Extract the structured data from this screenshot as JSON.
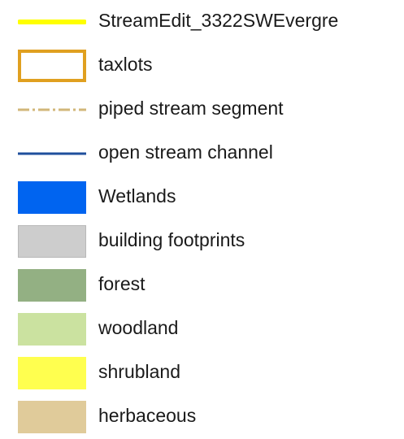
{
  "legend": {
    "items": [
      {
        "label": "StreamEdit_3322SWEvergre",
        "symbol": "line-solid-thick",
        "color": "#ffff00"
      },
      {
        "label": "taxlots",
        "symbol": "outline-box",
        "color": "#e0a020"
      },
      {
        "label": "piped stream segment",
        "symbol": "line-dash-dot",
        "color": "#d2b77a"
      },
      {
        "label": "open stream channel",
        "symbol": "line-solid",
        "color": "#1f4f9c"
      },
      {
        "label": "Wetlands",
        "symbol": "fill-box",
        "color": "#0064f0"
      },
      {
        "label": "building footprints",
        "symbol": "fill-box",
        "color": "#cdcdcd"
      },
      {
        "label": "forest",
        "symbol": "fill-box",
        "color": "#93b083"
      },
      {
        "label": "woodland",
        "symbol": "fill-box",
        "color": "#cbe2a0"
      },
      {
        "label": "shrubland",
        "symbol": "fill-box",
        "color": "#ffff4f"
      },
      {
        "label": "herbaceous",
        "symbol": "fill-box",
        "color": "#e0cb9a"
      }
    ]
  }
}
